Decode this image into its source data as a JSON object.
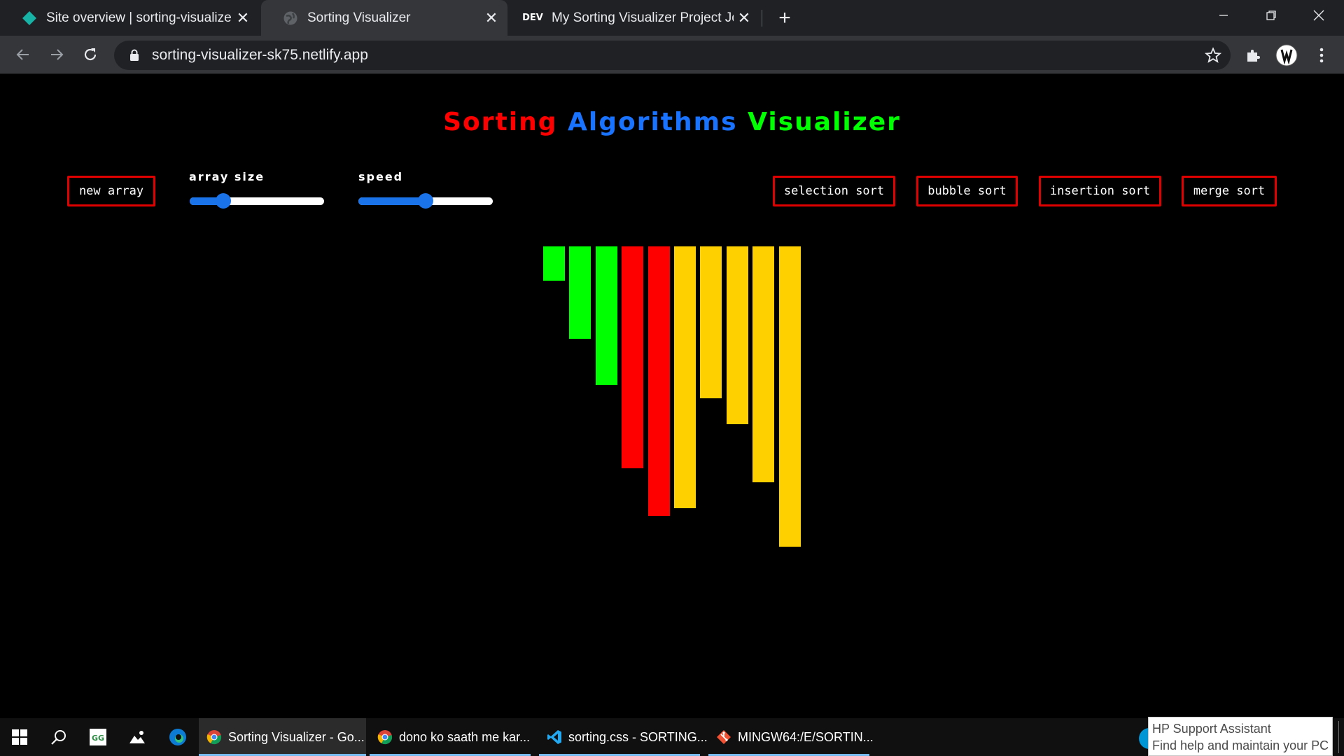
{
  "browser": {
    "tabs": [
      {
        "title": "Site overview | sorting-visualizer-",
        "favicon": "netlify-diamond-icon",
        "active": false
      },
      {
        "title": "Sorting Visualizer",
        "favicon": "globe-icon",
        "active": true
      },
      {
        "title": "My Sorting Visualizer Project Jou",
        "favicon": "dev-logo-icon",
        "favicon_text": "DEV",
        "active": false
      }
    ],
    "url": "sorting-visualizer-sk75.netlify.app"
  },
  "page": {
    "heading": {
      "word1": "Sorting",
      "word2": "Algorithms",
      "word3": "Visualizer"
    },
    "controls": {
      "new_array": "new array",
      "array_size_label": "array size",
      "array_size_value": 0.25,
      "speed_label": "speed",
      "speed_value": 0.5
    },
    "algorithms": [
      "selection sort",
      "bubble sort",
      "insertion sort",
      "merge sort"
    ],
    "bars": [
      {
        "value": 40,
        "color": "#00ff00"
      },
      {
        "value": 108,
        "color": "#00ff00"
      },
      {
        "value": 162,
        "color": "#00ff00"
      },
      {
        "value": 259,
        "color": "#ff0000"
      },
      {
        "value": 314,
        "color": "#ff0000"
      },
      {
        "value": 305,
        "color": "#ffd000"
      },
      {
        "value": 177,
        "color": "#ffd000"
      },
      {
        "value": 207,
        "color": "#ffd000"
      },
      {
        "value": 275,
        "color": "#ffd000"
      },
      {
        "value": 350,
        "color": "#ffd000"
      }
    ]
  },
  "taskbar": {
    "apps": [
      {
        "label": "Sorting Visualizer - Go...",
        "icon": "chrome-icon",
        "active": true
      },
      {
        "label": "dono ko saath me kar...",
        "icon": "chrome-icon",
        "active": false
      },
      {
        "label": "sorting.css - SORTING...",
        "icon": "vscode-icon",
        "active": false
      },
      {
        "label": "MINGW64:/E/SORTIN...",
        "icon": "git-bash-icon",
        "active": false
      }
    ],
    "notification": {
      "title": "HP Support Assistant",
      "body": "Find help and maintain your PC"
    }
  },
  "colors": {
    "button_border": "#e00000",
    "slider_accent": "#1a73e8",
    "sorted": "#00ff00",
    "compare": "#ff0000",
    "unsorted": "#ffd000"
  }
}
